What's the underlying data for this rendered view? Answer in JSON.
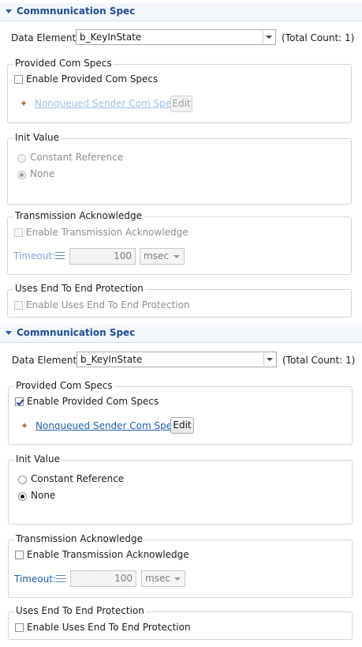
{
  "panels": [
    {
      "section_title": "Commnunication Spec",
      "data_elements_label": "Data Elements",
      "data_elements_value": "b_KeyInState",
      "total_count": "(Total Count: 1)",
      "provided_title": "Provided Com Specs",
      "enable_provided_label": "Enable Provided Com Specs",
      "enable_provided_checked": false,
      "nonqueued_link": "Nonqueued Sender Com Spec",
      "edit_label": "Edit",
      "init_value_title": "Init Value",
      "constant_reference_label": "Constant Reference",
      "none_label": "None",
      "none_selected": true,
      "transmission_title": "Transmission Acknowledge",
      "enable_transmission_label": "Enable Transmission Acknowledge",
      "timeout_label": "Timeout:",
      "timeout_value": "100",
      "timeout_unit": "msec",
      "e2e_title": "Uses End To End Protection",
      "enable_e2e_label": "Enable Uses End To End Protection",
      "enabled_state": false
    },
    {
      "section_title": "Commnunication Spec",
      "data_elements_label": "Data Elements",
      "data_elements_value": "b_KeyInState",
      "total_count": "(Total Count: 1)",
      "provided_title": "Provided Com Specs",
      "enable_provided_label": "Enable Provided Com Specs",
      "enable_provided_checked": true,
      "nonqueued_link": "Nonqueued Sender Com Spec",
      "edit_label": "Edit",
      "init_value_title": "Init Value",
      "constant_reference_label": "Constant Reference",
      "none_label": "None",
      "none_selected": true,
      "transmission_title": "Transmission Acknowledge",
      "enable_transmission_label": "Enable Transmission Acknowledge",
      "timeout_label": "Timeout:",
      "timeout_value": "100",
      "timeout_unit": "msec",
      "e2e_title": "Uses End To End Protection",
      "enable_e2e_label": "Enable Uses End To End Protection",
      "enabled_state": true
    }
  ]
}
